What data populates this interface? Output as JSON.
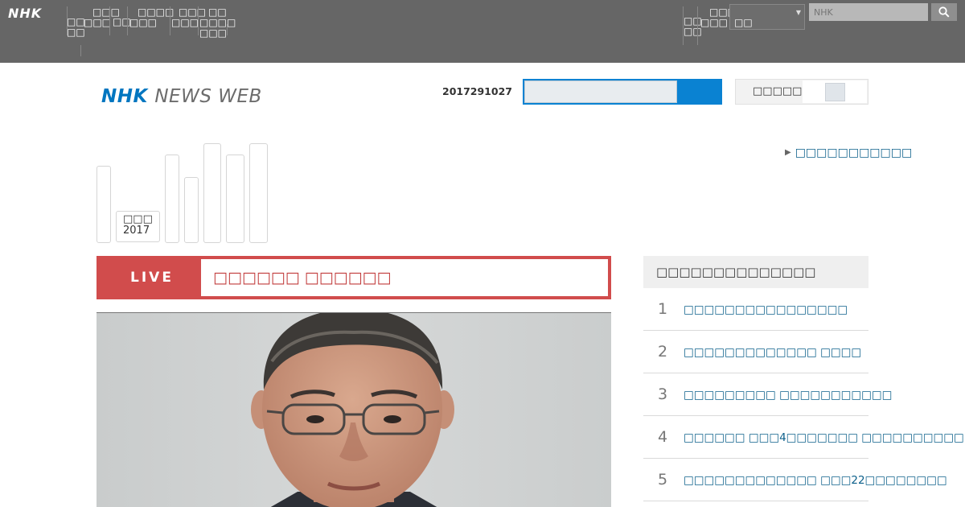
{
  "global_nav": {
    "logo": "NHK",
    "items": [
      {
        "lines": [
          "□□",
          "□□"
        ]
      },
      {
        "lines": [
          "□□□",
          "□□□"
        ]
      },
      {
        "lines": [
          "□□"
        ]
      },
      {
        "lines": [
          "□□□□",
          "□□□"
        ]
      },
      {
        "lines": [
          "□□□",
          "□□□"
        ]
      },
      {
        "lines": [
          "□□",
          "□□□□",
          "□□□"
        ]
      },
      {
        "lines": [
          "□□",
          "□□"
        ]
      },
      {
        "lines": [
          "□□□",
          "□□□"
        ]
      }
    ],
    "region_select": "□□",
    "search_placeholder": "NHK",
    "search_icon": "search-icon"
  },
  "header": {
    "brand_nhk": "NHK",
    "brand_rest": "NEWS WEB",
    "date": "2017291027",
    "font_size_label": "□□□□□"
  },
  "timeline": {
    "badge_line1": "□□□",
    "badge_line2": "2017",
    "link": "□□□□□□□□□□□"
  },
  "live": {
    "tag": "LIVE",
    "title": "□□□□□□ □□□□□□"
  },
  "ranking": {
    "heading": "□□□□□□□□□□□□□□",
    "items": [
      {
        "rank": "1",
        "title": "□□□□□□□□□□□□□□□□"
      },
      {
        "rank": "2",
        "title": "□□□□□□□□□□□□□ □□□□"
      },
      {
        "rank": "3",
        "title": "□□□□□□□□□ □□□□□□□□□□□"
      },
      {
        "rank": "4",
        "title": "□□□□□□ □□□4□□□□□□□ □□□□□□□□□□□□"
      },
      {
        "rank": "5",
        "title": "□□□□□□□□□□□□□ □□□22□□□□□□□□"
      }
    ]
  },
  "colors": {
    "nav_bg": "#666666",
    "brand_blue": "#0076c0",
    "live_red": "#d14c4c",
    "link_blue": "#0b5f8a"
  }
}
